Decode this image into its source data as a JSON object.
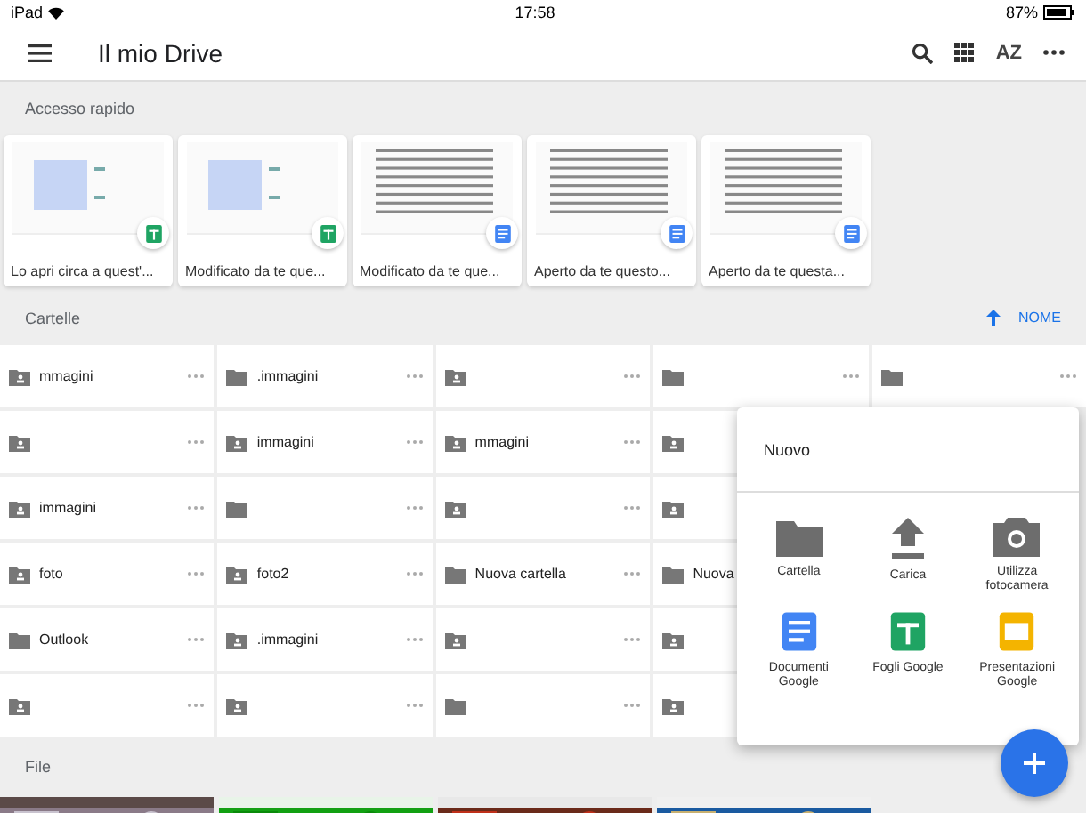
{
  "status_bar": {
    "device": "iPad",
    "time": "17:58",
    "battery": "87%"
  },
  "toolbar": {
    "title": "Il mio Drive",
    "sort_label": "AZ"
  },
  "quick_access": {
    "title": "Accesso rapido",
    "cards": [
      {
        "caption": "Lo apri circa a quest'...",
        "kind": "sheet"
      },
      {
        "caption": "Modificato da te que...",
        "kind": "sheet"
      },
      {
        "caption": "Modificato da te que...",
        "kind": "doc"
      },
      {
        "caption": "Aperto da te questo...",
        "kind": "doc"
      },
      {
        "caption": "Aperto da te questa...",
        "kind": "doc"
      }
    ]
  },
  "folders": {
    "title": "Cartelle",
    "sort": "NOME",
    "rows": [
      {
        "cells": [
          {
            "name": "mmagini",
            "kind": "shared"
          },
          {
            "name": ".immagini",
            "kind": "plain"
          },
          {
            "kind": "shared"
          },
          {
            "kind": "plain"
          },
          {
            "kind": "plain"
          }
        ]
      },
      {
        "cells": [
          {
            "kind": "shared"
          },
          {
            "name": "immagini",
            "kind": "shared"
          },
          {
            "name": "mmagini",
            "kind": "shared"
          },
          {
            "kind": "shared"
          }
        ]
      },
      {
        "cells": [
          {
            "name": "immagini",
            "kind": "shared"
          },
          {
            "kind": "plain"
          },
          {
            "kind": "shared"
          },
          {
            "kind": "shared"
          }
        ]
      },
      {
        "cells": [
          {
            "name": "foto",
            "kind": "shared"
          },
          {
            "name": "foto2",
            "kind": "shared"
          },
          {
            "name": "Nuova cartella",
            "kind": "plain"
          },
          {
            "name": "Nuova",
            "kind": "plain"
          }
        ]
      },
      {
        "cells": [
          {
            "name": "Outlook",
            "kind": "plain"
          },
          {
            "name": ".immagini",
            "kind": "shared"
          },
          {
            "kind": "shared"
          },
          {
            "kind": "shared"
          }
        ]
      },
      {
        "cells": [
          {
            "kind": "shared"
          },
          {
            "kind": "shared"
          },
          {
            "kind": "plain"
          },
          {
            "kind": "shared"
          }
        ]
      }
    ]
  },
  "files": {
    "title": "File"
  },
  "new_menu": {
    "title": "Nuovo",
    "items": [
      {
        "label": "Cartella",
        "kind": "folder"
      },
      {
        "label": "Carica",
        "kind": "upload"
      },
      {
        "label": "Utilizza fotocamera",
        "kind": "camera"
      },
      {
        "label": "Documenti Google",
        "kind": "docs"
      },
      {
        "label": "Fogli Google",
        "kind": "sheets"
      },
      {
        "label": "Presentazioni Google",
        "kind": "slides"
      }
    ]
  }
}
